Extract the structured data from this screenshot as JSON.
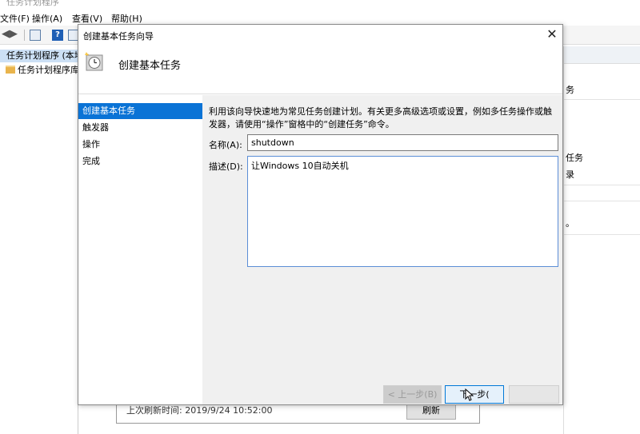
{
  "background_window": {
    "title": "任务计划程序",
    "menu": [
      "文件(F)",
      "操作(A)",
      "查看(V)",
      "帮助(H)"
    ],
    "tree": {
      "root": "任务计划程序 (本地)",
      "child": "任务计划程序库"
    },
    "right_panel": {
      "items": [
        "务",
        "任务",
        "录",
        "。"
      ]
    },
    "bottom": {
      "last_refresh": "上次刷新时间: 2019/9/24 10:52:00",
      "refresh_button": "刷新"
    }
  },
  "dialog": {
    "title": "创建基本任务向导",
    "heading": "创建基本任务",
    "nav": [
      {
        "label": "创建基本任务",
        "active": true
      },
      {
        "label": "触发器",
        "active": false
      },
      {
        "label": "操作",
        "active": false
      },
      {
        "label": "完成",
        "active": false
      }
    ],
    "description": "利用该向导快速地为常见任务创建计划。有关更多高级选项或设置，例如多任务操作或触发器，请使用“操作”窗格中的“创建任务”命令。",
    "name_label": "名称(A):",
    "name_value": "shutdown",
    "desc_label": "描述(D):",
    "desc_value": "让Windows 10自动关机",
    "buttons": {
      "back": "< 上一步(B)",
      "next": "下一步(",
      "cancel": ""
    }
  },
  "colors": {
    "accent": "#0a73d6",
    "nav_active_bg": "#0a73d6",
    "body_bg": "#f0f0f0",
    "tree_selected": "#cce0f5"
  }
}
